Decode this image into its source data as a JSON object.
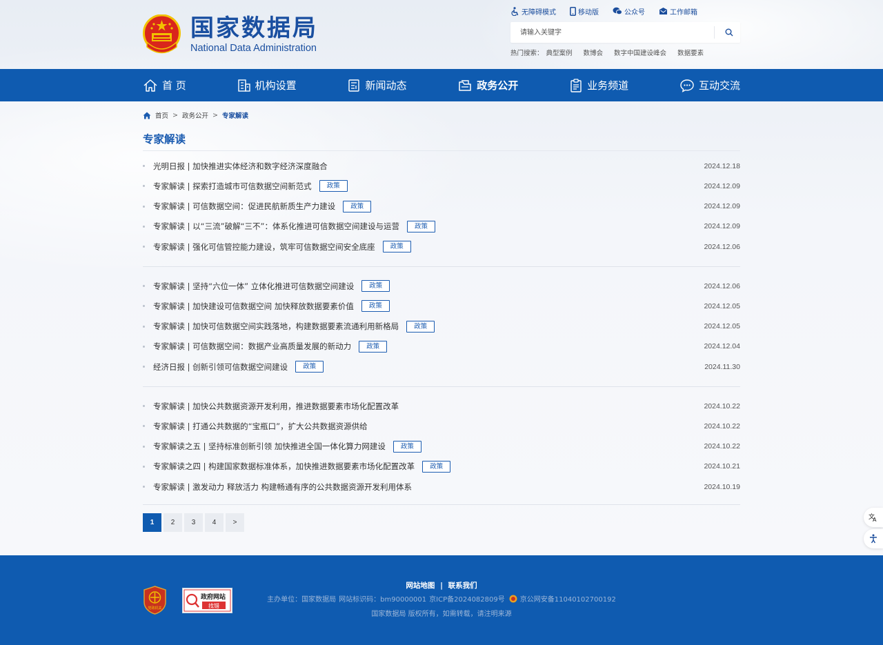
{
  "site": {
    "name_cn": "国家数据局",
    "name_en": "National Data Administration"
  },
  "top_links": [
    {
      "label": "无障碍模式",
      "icon": "accessibility-icon"
    },
    {
      "label": "移动版",
      "icon": "mobile-icon"
    },
    {
      "label": "公众号",
      "icon": "wechat-icon"
    },
    {
      "label": "工作邮箱",
      "icon": "mail-icon"
    }
  ],
  "search": {
    "placeholder": "请输入关键字"
  },
  "hot_search": {
    "label": "热门搜索：",
    "items": [
      "典型案例",
      "数博会",
      "数字中国建设峰会",
      "数据要素"
    ]
  },
  "nav": [
    {
      "label": "首 页",
      "icon": "home-icon"
    },
    {
      "label": "机构设置",
      "icon": "building-icon"
    },
    {
      "label": "新闻动态",
      "icon": "news-icon"
    },
    {
      "label": "政务公开",
      "icon": "folder-icon",
      "active": true
    },
    {
      "label": "业务频道",
      "icon": "clipboard-icon"
    },
    {
      "label": "互动交流",
      "icon": "chat-icon"
    }
  ],
  "breadcrumb": {
    "home": "首页",
    "sep": ">",
    "level1": "政务公开",
    "current": "专家解读"
  },
  "section_title": "专家解读",
  "tag_label": "政策",
  "groups": [
    [
      {
        "title": "光明日报 | 加快推进实体经济和数字经济深度融合",
        "tag": false,
        "date": "2024.12.18"
      },
      {
        "title": "专家解读 | 探索打造城市可信数据空间新范式",
        "tag": true,
        "date": "2024.12.09"
      },
      {
        "title": "专家解读 | 可信数据空间：促进民航新质生产力建设",
        "tag": true,
        "date": "2024.12.09"
      },
      {
        "title": "专家解读 | 以“三流”破解“三不”：体系化推进可信数据空间建设与运营",
        "tag": true,
        "date": "2024.12.09"
      },
      {
        "title": "专家解读 | 强化可信管控能力建设，筑牢可信数据空间安全底座",
        "tag": true,
        "date": "2024.12.06"
      }
    ],
    [
      {
        "title": "专家解读 | 坚持“六位一体” 立体化推进可信数据空间建设",
        "tag": true,
        "date": "2024.12.06"
      },
      {
        "title": "专家解读 | 加快建设可信数据空间 加快释放数据要素价值",
        "tag": true,
        "date": "2024.12.05"
      },
      {
        "title": "专家解读 | 加快可信数据空间实践落地，构建数据要素流通利用新格局",
        "tag": true,
        "date": "2024.12.05"
      },
      {
        "title": "专家解读 | 可信数据空间：数据产业高质量发展的新动力",
        "tag": true,
        "date": "2024.12.04"
      },
      {
        "title": "经济日报 | 创新引领可信数据空间建设",
        "tag": true,
        "date": "2024.11.30"
      }
    ],
    [
      {
        "title": "专家解读 | 加快公共数据资源开发利用，推进数据要素市场化配置改革",
        "tag": false,
        "date": "2024.10.22"
      },
      {
        "title": "专家解读 | 打通公共数据的“宝瓶口”，扩大公共数据资源供给",
        "tag": false,
        "date": "2024.10.22"
      },
      {
        "title": "专家解读之五 | 坚持标准创新引领 加快推进全国一体化算力网建设",
        "tag": true,
        "date": "2024.10.22"
      },
      {
        "title": "专家解读之四 | 构建国家数据标准体系，加快推进数据要素市场化配置改革",
        "tag": true,
        "date": "2024.10.21"
      },
      {
        "title": "专家解读 | 激发动力 释放活力 构建畅通有序的公共数据资源开发利用体系",
        "tag": false,
        "date": "2024.10.19"
      }
    ]
  ],
  "pagination": [
    "1",
    "2",
    "3",
    "4",
    ">"
  ],
  "pagination_current": "1",
  "footer": {
    "sitemap": "网站地图",
    "divider": "|",
    "contact": "联系我们",
    "host": "主办单位：国家数据局",
    "site_id": "网站标识码：bm90000001",
    "icp": "京ICP备2024082809号",
    "police": "京公网安备11040102700192",
    "copyright": "国家数据局 版权所有，如需转载，请注明来源",
    "badge_label_1": "党政机关",
    "badge2_line1": "政府网站",
    "badge2_line2": "找错"
  },
  "colors": {
    "brand_blue": "#0f5bb0",
    "title_blue": "#1a5bb0",
    "emblem_red": "#d9261c",
    "emblem_gold": "#f2c200"
  }
}
